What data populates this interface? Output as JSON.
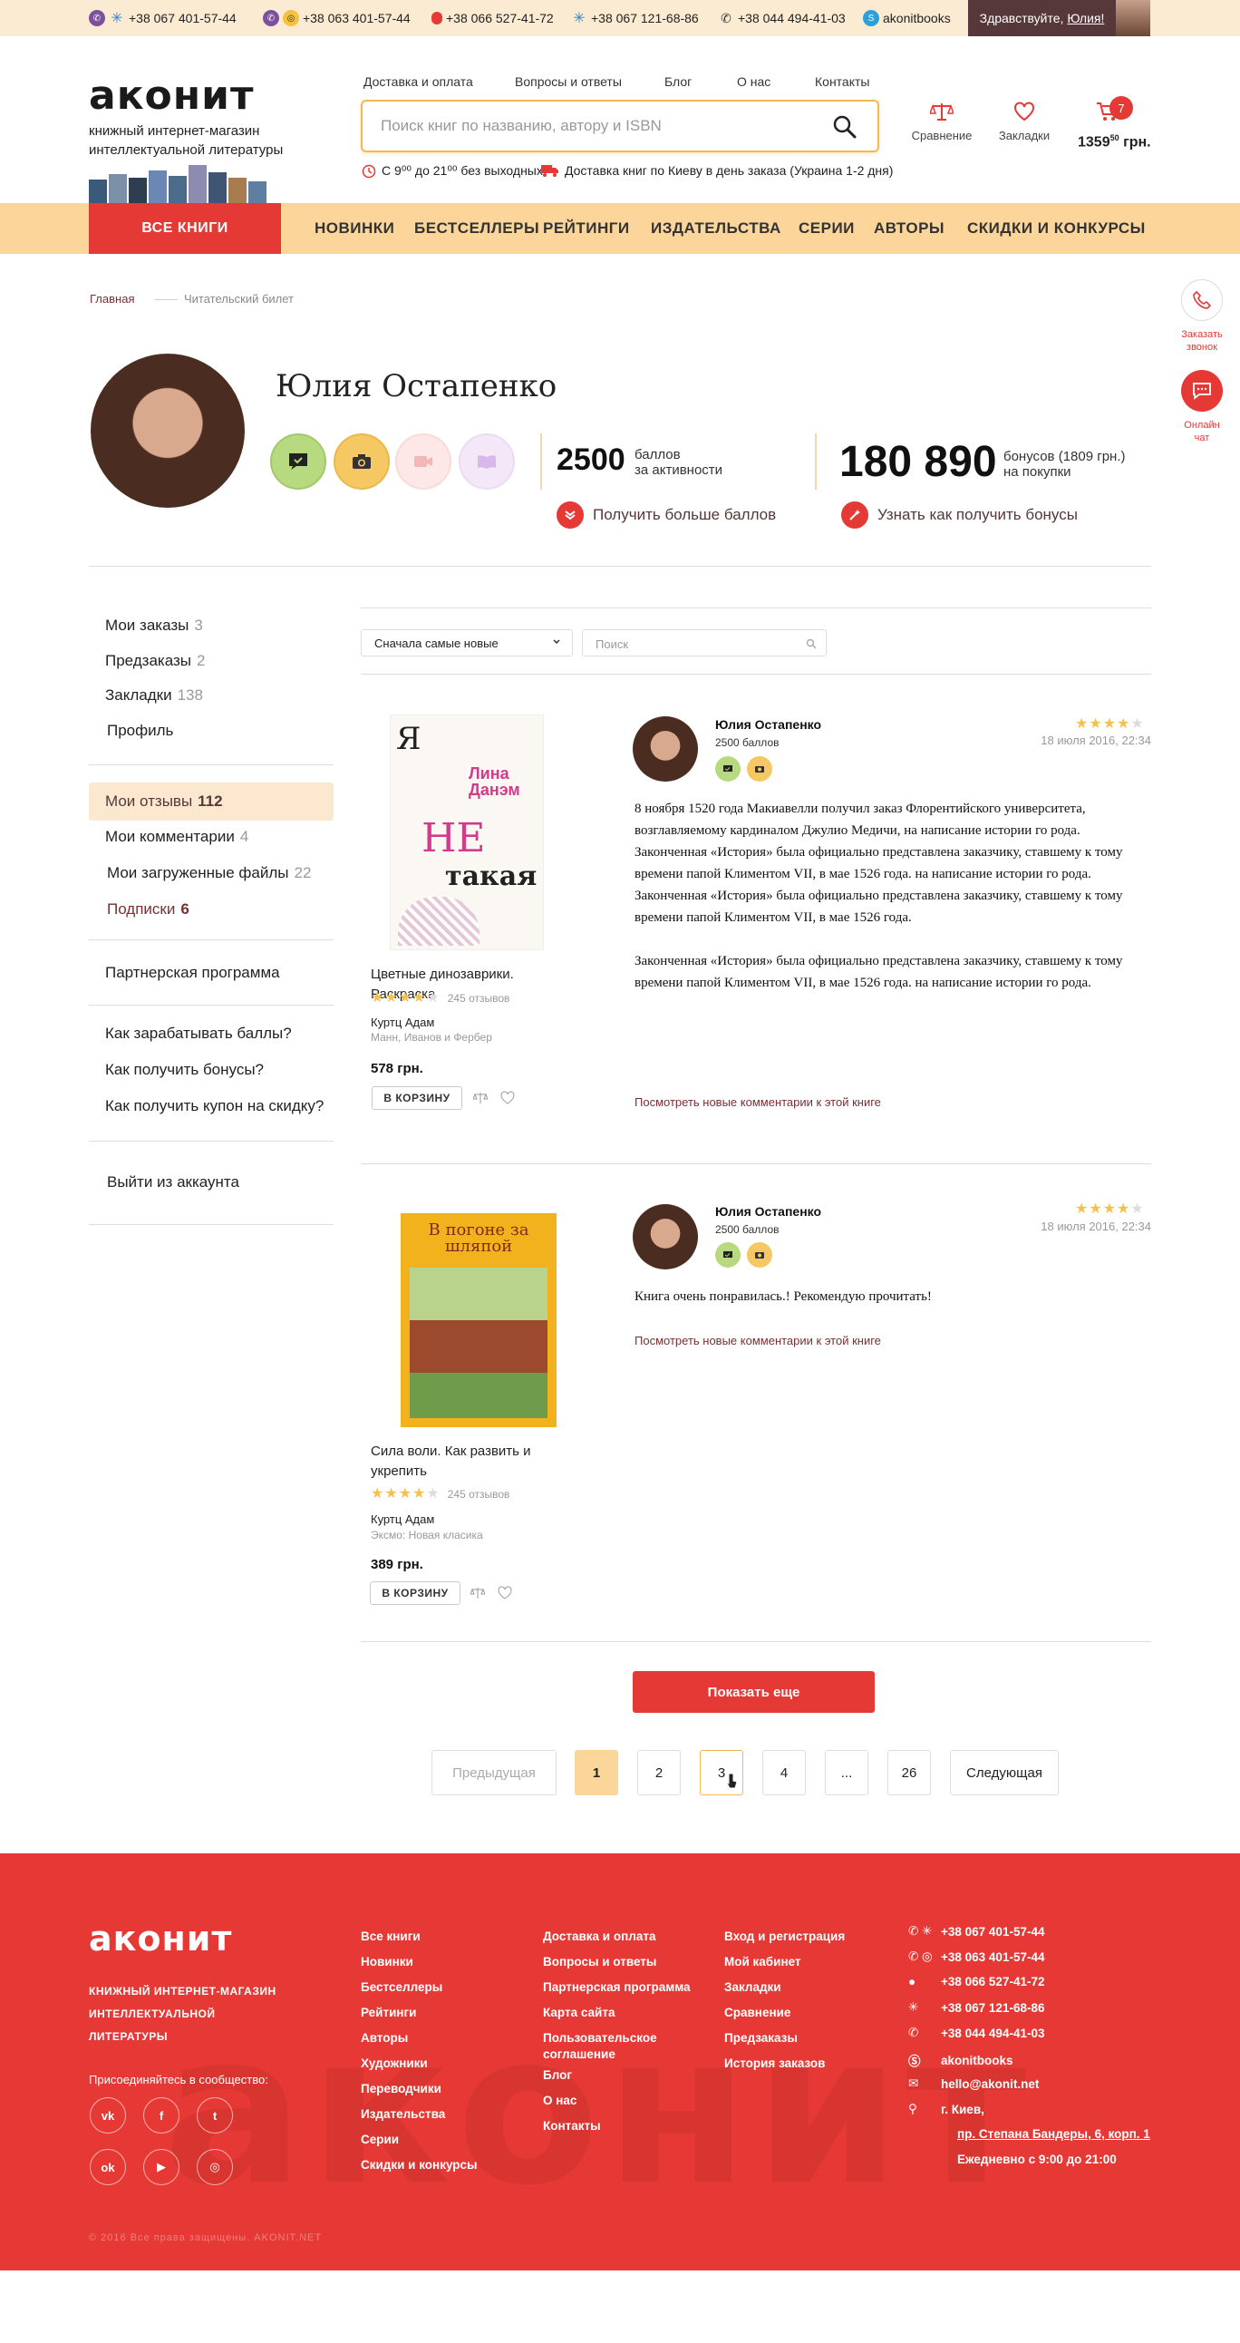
{
  "topbar": {
    "phones": [
      "+38 067 401-57-44",
      "+38 063 401-57-44",
      "+38 066 527-41-72",
      "+38 067 121-68-86",
      "+38 044 494-41-03"
    ],
    "skype": "akonitbooks",
    "greeting": "Здравствуйте,",
    "user_first": "Юлия!"
  },
  "header": {
    "logo": "аконит",
    "tagline": "книжный интернет-магазин интеллектуальной литературы",
    "nav": [
      "Доставка и оплата",
      "Вопросы и ответы",
      "Блог",
      "О нас",
      "Контакты"
    ],
    "search_placeholder": "Поиск книг по названию, автору и ISBN",
    "hours": "С 9⁰⁰ до 21⁰⁰ без выходных",
    "delivery": "Доставка книг по Киеву в день заказа (Украина 1-2 дня)",
    "compare": "Сравнение",
    "bookmarks": "Закладки",
    "cart_count": "7",
    "cart_sum": "1359",
    "cart_sum_kop": "50",
    "cart_cur": "грн."
  },
  "menu": {
    "all": "ВСЕ КНИГИ",
    "items": [
      "НОВИНКИ",
      "БЕСТСЕЛЛЕРЫ",
      "РЕЙТИНГИ",
      "ИЗДАТЕЛЬСТВА",
      "СЕРИИ",
      "АВТОРЫ",
      "СКИДКИ И КОНКУРСЫ"
    ]
  },
  "float": {
    "call": "Заказать звонок",
    "chat": "Онлайн чат"
  },
  "breadcrumb": {
    "home": "Главная",
    "current": "Читательский билет"
  },
  "profile": {
    "name": "Юлия Остапенко",
    "points": "2500",
    "points_label1": "баллов",
    "points_label2": "за активности",
    "more_points": "Получить больше баллов",
    "bonus": "180 890",
    "bonus_label1": "бонусов (1809 грн.)",
    "bonus_label2": "на покупки",
    "how_bonus": "Узнать как получить бонусы"
  },
  "leftmenu": {
    "orders": "Мои заказы",
    "orders_c": "3",
    "preorders": "Предзаказы",
    "preorders_c": "2",
    "bookmarks": "Закладки",
    "bookmarks_c": "138",
    "profile": "Профиль",
    "reviews": "Мои отзывы",
    "reviews_c": "112",
    "comments": "Мои комментарии",
    "comments_c": "4",
    "files": "Мои загруженные файлы",
    "files_c": "22",
    "subs": "Подписки",
    "subs_c": "6",
    "partner": "Партнерская программа",
    "earn": "Как зарабатывать баллы?",
    "get_bonus": "Как получить бонусы?",
    "coupon": "Как получить купон на скидку?",
    "logout": "Выйти из аккаунта"
  },
  "filters": {
    "sort": "Сначала самые новые",
    "search_placeholder": "Поиск"
  },
  "reviews": [
    {
      "book_title": "Цветные динозаврики. Раскраска",
      "cover_author": "Лина Данэм",
      "cover_title_top": "Я",
      "cover_title_mid": "НЕ",
      "cover_title_bot": "такая",
      "reviews_count": "245 отзывов",
      "author": "Куртц Адам",
      "publisher": "Манн, Иванов и Фербер",
      "price": "578 грн.",
      "to_cart": "В КОРЗИНУ",
      "reviewer": "Юлия Остапенко",
      "reviewer_points": "2500 баллов",
      "date": "18 июля 2016, 22:34",
      "text1": "8 ноября 1520 года Макиавелли получил заказ Флорентийского университета, возглавляемому кардиналом Джулио Медичи, на написание истории го  рода. Законченная «История» была официально представлена заказчику, ставшему к тому времени папой Климентом VII, в мае 1526 года.  на написание истории го рода. Законченная «История» была официально представлена заказчику, ставшему к тому времени папой Климентом VII, в мае 1526 года.",
      "text2": "Законченная «История» была официально представлена заказчику, ставшему к тому времени папой Климентом VII, в мае 1526 года.  на написание истории го рода.",
      "link": "Посмотреть новые комментарии к этой книге"
    },
    {
      "book_title": "Сила воли. Как развить и укрепить",
      "cover_title": "В погоне за шляпой",
      "reviews_count": "245 отзывов",
      "author": "Куртц Адам",
      "publisher": "Эксмо: Новая класика",
      "price": "389 грн.",
      "to_cart": "В КОРЗИНУ",
      "reviewer": "Юлия Остапенко",
      "reviewer_points": "2500 баллов",
      "date": "18 июля 2016, 22:34",
      "text1": "Книга очень понравилась.! Рекомендую прочитать!",
      "link": "Посмотреть новые комментарии к этой книге"
    }
  ],
  "show_more": "Показать еще",
  "pagination": {
    "prev": "Предыдущая",
    "pages": [
      "1",
      "2",
      "3",
      "4",
      "...",
      "26"
    ],
    "next": "Следующая",
    "current": "1"
  },
  "footer": {
    "logo": "аконит",
    "tagline": "КНИЖНЫЙ ИНТЕРНЕТ-МАГАЗИН ИНТЕЛЛЕКТУАЛЬНОЙ ЛИТЕРАТУРЫ",
    "join": "Присоединяйтесь в сообщество:",
    "col1": [
      "Все книги",
      "Новинки",
      "Бестселлеры",
      "Рейтинги",
      "Авторы",
      "Художники",
      "Переводчики",
      "Издательства",
      "Серии",
      "Скидки и конкурсы"
    ],
    "col2": [
      "Доставка и оплата",
      "Вопросы и ответы",
      "Партнерская программа",
      "Карта сайта",
      "Пользовательское",
      "соглашение",
      "Блог",
      "О нас",
      "Контакты"
    ],
    "col3": [
      "Вход и регистрация",
      "Мой кабинет",
      "Закладки",
      "Сравнение",
      "Предзаказы",
      "История заказов"
    ],
    "phones": [
      "+38 067 401-57-44",
      "+38 063 401-57-44",
      "+38 066 527-41-72",
      "+38 067 121-68-86",
      "+38 044 494-41-03"
    ],
    "skype": "akonitbooks",
    "email": "hello@akonit.net",
    "city": "г. Киев,",
    "street": "пр. Степана Бандеры, 6, корп. 1",
    "hours": "Ежедневно с 9:00 до 21:00",
    "copyright": "© 2016 Все права защищены. AKONIT.NET"
  },
  "colors": {
    "brand": "#e53935",
    "menu": "#fbd59a",
    "topbar": "#fcebd3",
    "accent_dark": "#56383a"
  }
}
